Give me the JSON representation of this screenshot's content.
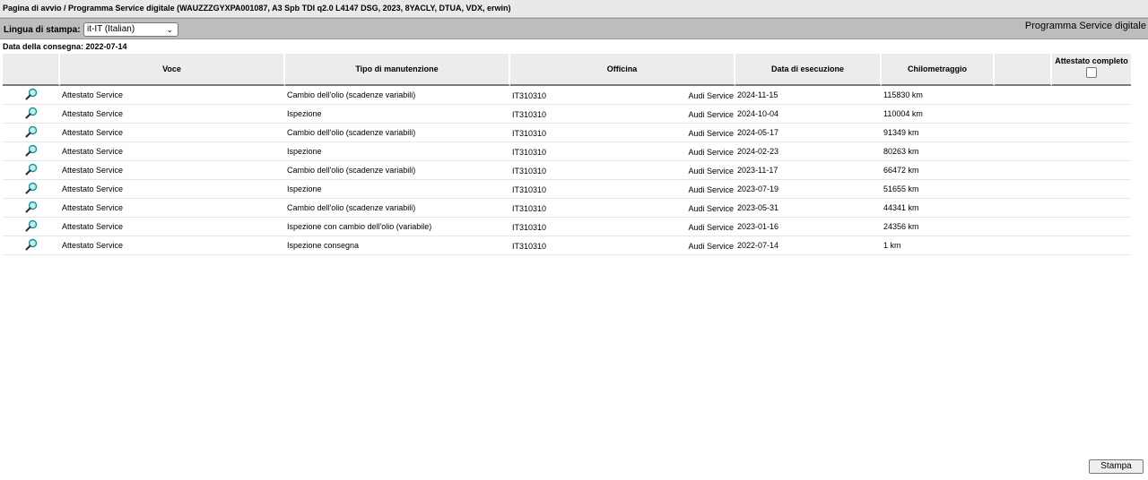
{
  "breadcrumb": "Pagina di avvio / Programma Service digitale (WAUZZZGYXPA001087, A3 Spb TDI q2.0 L4147 DSG, 2023, 8YACLY, DTUA, VDX, erwin)",
  "toolbar": {
    "language_label": "Lingua di stampa:",
    "language_value": "it-IT (Italian)",
    "program_title": "Programma Service digitale"
  },
  "delivery_date": "Data della consegna: 2022-07-14",
  "table": {
    "headers": {
      "voce": "Voce",
      "tipo": "Tipo di manutenzione",
      "officina": "Officina",
      "data": "Data di esecuzione",
      "km": "Chilometraggio",
      "attestato": "Attestato completo"
    },
    "rows": [
      {
        "voce": "Attestato Service",
        "tipo": "Cambio dell'olio (scadenze variabili)",
        "code": "IT310310",
        "officina": "Audi Service",
        "data": "2024-11-15",
        "km": "115830 km"
      },
      {
        "voce": "Attestato Service",
        "tipo": "Ispezione",
        "code": "IT310310",
        "officina": "Audi Service",
        "data": "2024-10-04",
        "km": "110004 km"
      },
      {
        "voce": "Attestato Service",
        "tipo": "Cambio dell'olio (scadenze variabili)",
        "code": "IT310310",
        "officina": "Audi Service",
        "data": "2024-05-17",
        "km": "91349 km"
      },
      {
        "voce": "Attestato Service",
        "tipo": "Ispezione",
        "code": "IT310310",
        "officina": "Audi Service",
        "data": "2024-02-23",
        "km": "80263 km"
      },
      {
        "voce": "Attestato Service",
        "tipo": "Cambio dell'olio (scadenze variabili)",
        "code": "IT310310",
        "officina": "Audi Service",
        "data": "2023-11-17",
        "km": "66472 km"
      },
      {
        "voce": "Attestato Service",
        "tipo": "Ispezione",
        "code": "IT310310",
        "officina": "Audi Service",
        "data": "2023-07-19",
        "km": "51655 km"
      },
      {
        "voce": "Attestato Service",
        "tipo": "Cambio dell'olio (scadenze variabili)",
        "code": "IT310310",
        "officina": "Audi Service",
        "data": "2023-05-31",
        "km": "44341 km"
      },
      {
        "voce": "Attestato Service",
        "tipo": "Ispezione con cambio dell'olio (variabile)",
        "code": "IT310310",
        "officina": "Audi Service",
        "data": "2023-01-16",
        "km": "24356 km"
      },
      {
        "voce": "Attestato Service",
        "tipo": "Ispezione consegna",
        "code": "IT310310",
        "officina": "Audi Service",
        "data": "2022-07-14",
        "km": "1 km"
      }
    ]
  },
  "print_button": "Stampa",
  "icons": {
    "row_view": "magnifier-icon",
    "select_chevron": "chevron-down-icon"
  },
  "colors": {
    "toolbar": "#bdbdbd",
    "header": "#ececec",
    "magnifier_lens": "#20b3b3"
  }
}
